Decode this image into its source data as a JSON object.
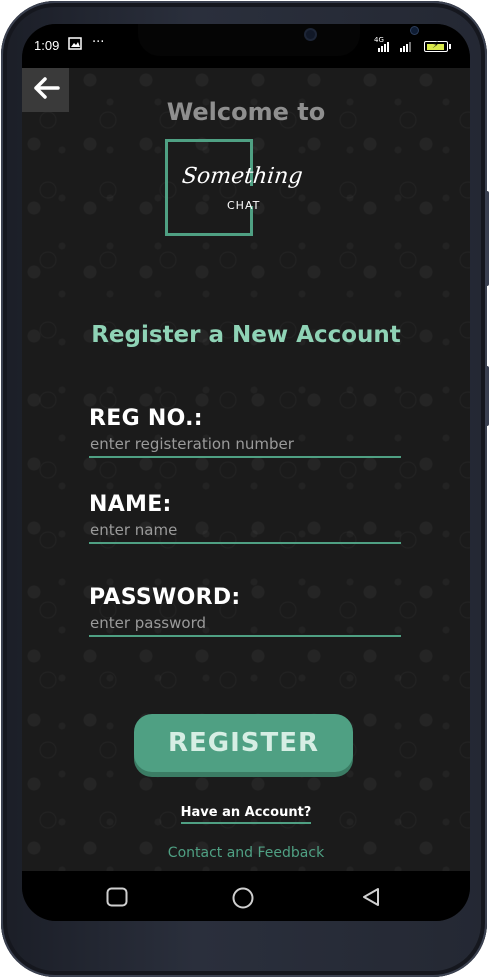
{
  "status_bar": {
    "time": "1:09",
    "more": "···",
    "network_label": "4G",
    "icons": [
      "image-icon",
      "signal-icon",
      "battery-icon"
    ]
  },
  "header": {
    "back_icon": "arrow-left-icon",
    "welcome_text": "Welcome to"
  },
  "logo": {
    "script_text": "Something",
    "sub_text": "CHAT"
  },
  "form": {
    "heading": "Register a New Account",
    "reg_no": {
      "label": "REG NO.:",
      "placeholder": "enter registeration number",
      "value": ""
    },
    "name": {
      "label": "NAME:",
      "placeholder": "enter name",
      "value": ""
    },
    "password": {
      "label": "PASSWORD:",
      "placeholder": "enter password",
      "value": ""
    },
    "register_label": "REGISTER",
    "have_account_label": "Have an Account?",
    "contact_label": "Contact and Feedback"
  },
  "navigation_bar": {
    "icons": [
      "recent-apps-icon",
      "home-icon",
      "back-triangle-icon"
    ]
  },
  "colors": {
    "accent": "#4fa083",
    "heading": "#8fd3b6",
    "welcome": "#8f8f8f",
    "background": "#1b1b1b"
  }
}
